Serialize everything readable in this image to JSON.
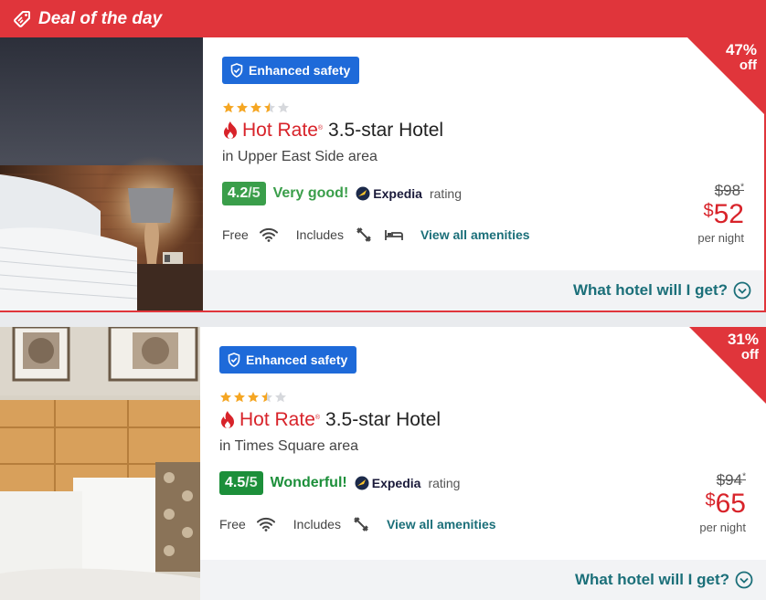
{
  "deal_header": {
    "label": "Deal of the day"
  },
  "hotels": [
    {
      "safety_badge": "Enhanced safety",
      "stars_value": 3.5,
      "hot_rate": "Hot Rate",
      "star_class": "3.5-star Hotel",
      "area": "in Upper East Side area",
      "score": "4.2",
      "score_denom": "/5",
      "score_color": "#3a9e4a",
      "verdict": "Very good!",
      "verdict_color": "#3a9e4a",
      "provider": "Expedia",
      "rating_word": "rating",
      "free_label": "Free",
      "includes_label": "Includes",
      "amenity_icons": [
        "wifi-icon",
        "fitness-icon",
        "bed-icon"
      ],
      "view_amenities": "View all amenities",
      "old_price": "$98",
      "old_price_mark": "*",
      "currency": "$",
      "new_price": "52",
      "per_night": "per night",
      "discount": "47%",
      "discount_off": "off",
      "what_hotel": "What hotel will I get?"
    },
    {
      "safety_badge": "Enhanced safety",
      "stars_value": 3.5,
      "hot_rate": "Hot Rate",
      "star_class": "3.5-star Hotel",
      "area": "in Times Square area",
      "score": "4.5",
      "score_denom": "/5",
      "score_color": "#1c8f3a",
      "verdict": "Wonderful!",
      "verdict_color": "#1c8f3a",
      "provider": "Expedia",
      "rating_word": "rating",
      "free_label": "Free",
      "includes_label": "Includes",
      "amenity_icons": [
        "wifi-icon",
        "fitness-icon"
      ],
      "view_amenities": "View all amenities",
      "old_price": "$94",
      "old_price_mark": "*",
      "currency": "$",
      "new_price": "65",
      "per_night": "per night",
      "discount": "31%",
      "discount_off": "off",
      "what_hotel": "What hotel will I get?"
    }
  ],
  "colors": {
    "accent_red": "#e0353b",
    "safety_blue": "#1e6ad9",
    "link_teal": "#1b6f79",
    "star_gold": "#f5a623"
  }
}
